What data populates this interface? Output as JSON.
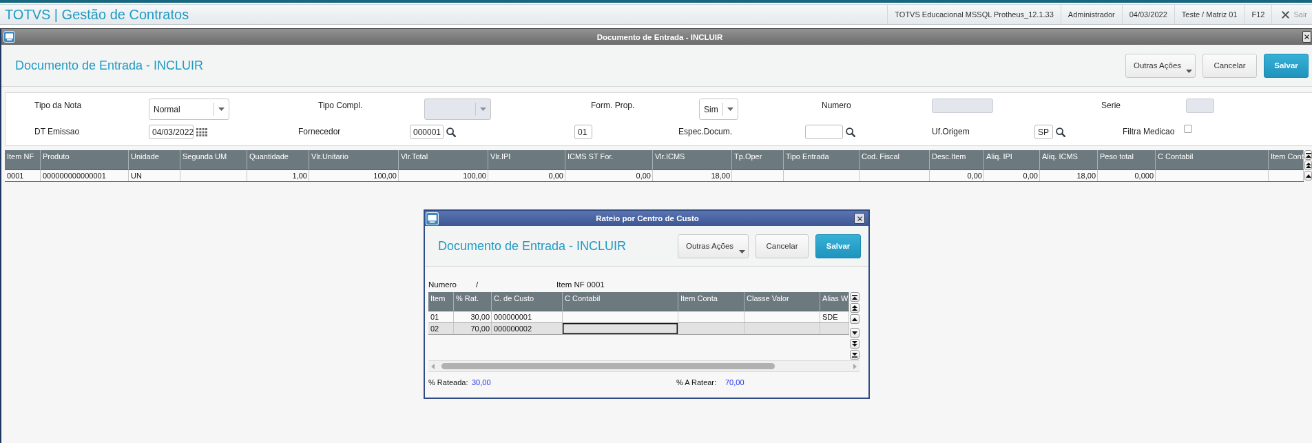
{
  "app_header": {
    "title": "TOTVS | Gestão de Contratos",
    "info": [
      "TOTVS Educacional MSSQL Protheus_12.1.33",
      "Administrador",
      "04/03/2022",
      "Teste / Matriz 01",
      "F12"
    ],
    "exit": {
      "label": "Sair",
      "disabled": true
    }
  },
  "window": {
    "title": "Documento de Entrada - INCLUIR",
    "heading": "Documento de Entrada - INCLUIR",
    "actions": [
      {
        "label": "Outras Ações",
        "kind": "menu"
      },
      {
        "label": "Cancelar",
        "kind": "secondary"
      },
      {
        "label": "Salvar",
        "kind": "primary"
      }
    ]
  },
  "form": {
    "rows": [
      {
        "fields": [
          {
            "label": "Tipo da Nota",
            "kind": "select",
            "value": "Normal",
            "disabled": false
          },
          {
            "label": "Tipo Compl.",
            "kind": "select",
            "disabled": true
          },
          {
            "label": "Form. Prop.",
            "kind": "select",
            "value": "Sim",
            "disabled": false
          },
          {
            "label": "Numero",
            "kind": "input",
            "disabled": true
          },
          {
            "label": "Serie",
            "kind": "input",
            "disabled": true
          }
        ]
      },
      {
        "fields": [
          {
            "label": "DT Emissao",
            "kind": "date",
            "value": "04/03/2022",
            "disabled": false
          },
          {
            "label": "Fornecedor",
            "kind": "lookup",
            "value": "000001",
            "disabled": false
          },
          {
            "kind": "input",
            "value": "01",
            "disabled": false
          },
          {
            "label": "Espec.Docum.",
            "kind": "lookup",
            "disabled": false
          },
          {
            "label": "Uf.Origem",
            "kind": "lookup",
            "value": "SP",
            "disabled": false
          },
          {
            "label": "Filtra Medicao",
            "kind": "checkbox",
            "checked": false,
            "disabled": false
          }
        ]
      }
    ]
  },
  "grid": {
    "columns": [
      {
        "label": "Item NF",
        "kind": "text"
      },
      {
        "label": "Produto",
        "kind": "text"
      },
      {
        "label": "Unidade",
        "kind": "text"
      },
      {
        "label": "Segunda UM",
        "kind": "text"
      },
      {
        "label": "Quantidade",
        "kind": "number"
      },
      {
        "label": "Vlr.Unitario",
        "kind": "number"
      },
      {
        "label": "Vlr.Total",
        "kind": "number"
      },
      {
        "label": "Vlr.IPI",
        "kind": "number"
      },
      {
        "label": "ICMS ST For.",
        "kind": "number"
      },
      {
        "label": "Vlr.ICMS",
        "kind": "number"
      },
      {
        "label": "Tp.Oper",
        "kind": "text"
      },
      {
        "label": "Tipo Entrada",
        "kind": "text"
      },
      {
        "label": "Cod. Fiscal",
        "kind": "text"
      },
      {
        "label": "Desc.Item",
        "kind": "number"
      },
      {
        "label": "Aliq. IPI",
        "kind": "number"
      },
      {
        "label": "Aliq. ICMS",
        "kind": "number"
      },
      {
        "label": "Peso total",
        "kind": "number"
      },
      {
        "label": "C Contabil",
        "kind": "text"
      },
      {
        "label": "Item Cont",
        "kind": "text"
      }
    ],
    "rows": [
      {
        "cells": [
          "0001",
          "000000000000001",
          "UN",
          null,
          "1,00",
          "100,00",
          "100,00",
          "0,00",
          "0,00",
          "18,00",
          null,
          null,
          null,
          "0,00",
          "0,00",
          "18,00",
          "0,000",
          null,
          null
        ]
      }
    ]
  },
  "dialog": {
    "title": "Rateio por Centro de Custo",
    "heading": "Documento de Entrada - INCLUIR",
    "actions": [
      {
        "label": "Outras Ações",
        "kind": "menu"
      },
      {
        "label": "Cancelar",
        "kind": "secondary"
      },
      {
        "label": "Salvar",
        "kind": "primary"
      }
    ],
    "info": [
      "Numero",
      "/",
      "Item NF 0001"
    ],
    "grid": {
      "columns": [
        {
          "label": "Item",
          "kind": "text"
        },
        {
          "label": "% Rat.",
          "kind": "number"
        },
        {
          "label": "C. de Custo",
          "kind": "text"
        },
        {
          "label": "C Contabil",
          "kind": "text"
        },
        {
          "label": "Item Conta",
          "kind": "text"
        },
        {
          "label": "Classe Valor",
          "kind": "text"
        },
        {
          "label": "Alias W",
          "kind": "text"
        }
      ],
      "rows": [
        {
          "selected": false,
          "cells": [
            {
              "text": "01",
              "focused": false
            },
            {
              "text": "30,00",
              "focused": false
            },
            {
              "text": "000000001",
              "focused": false
            },
            {
              "focused": false
            },
            {
              "focused": false
            },
            {
              "focused": false
            },
            {
              "text": "SDE",
              "focused": false
            }
          ]
        },
        {
          "selected": true,
          "cells": [
            {
              "text": "02",
              "focused": false
            },
            {
              "text": "70,00",
              "focused": false
            },
            {
              "text": "000000002",
              "focused": false
            },
            {
              "focused": true
            },
            {
              "focused": false
            },
            {
              "focused": false
            },
            {
              "focused": false
            }
          ]
        }
      ]
    },
    "totals": [
      {
        "label": "% Rateada:",
        "value": "30,00"
      },
      {
        "label": "% A Ratear:",
        "value": "70,00"
      }
    ]
  }
}
